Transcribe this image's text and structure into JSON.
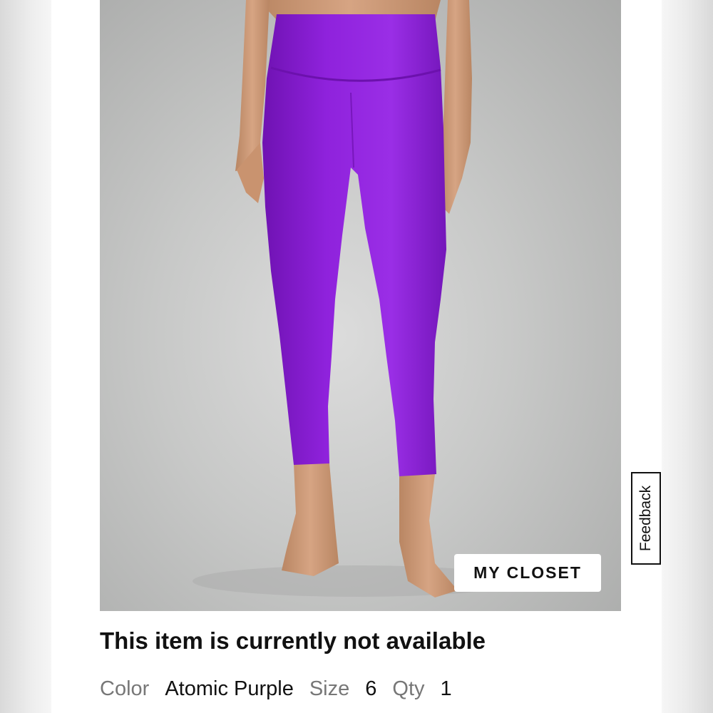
{
  "product": {
    "image_alt": "Purple high-rise leggings",
    "closet_button_label": "MY CLOSET",
    "availability_message": "This item is currently not available",
    "details": {
      "color_label": "Color",
      "color_value": "Atomic Purple",
      "size_label": "Size",
      "size_value": "6",
      "qty_label": "Qty",
      "qty_value": "1"
    }
  },
  "feedback": {
    "label": "Feedback"
  },
  "colors": {
    "product_purple": "#8b1bd6",
    "text_primary": "#111111",
    "text_muted": "#777777"
  }
}
